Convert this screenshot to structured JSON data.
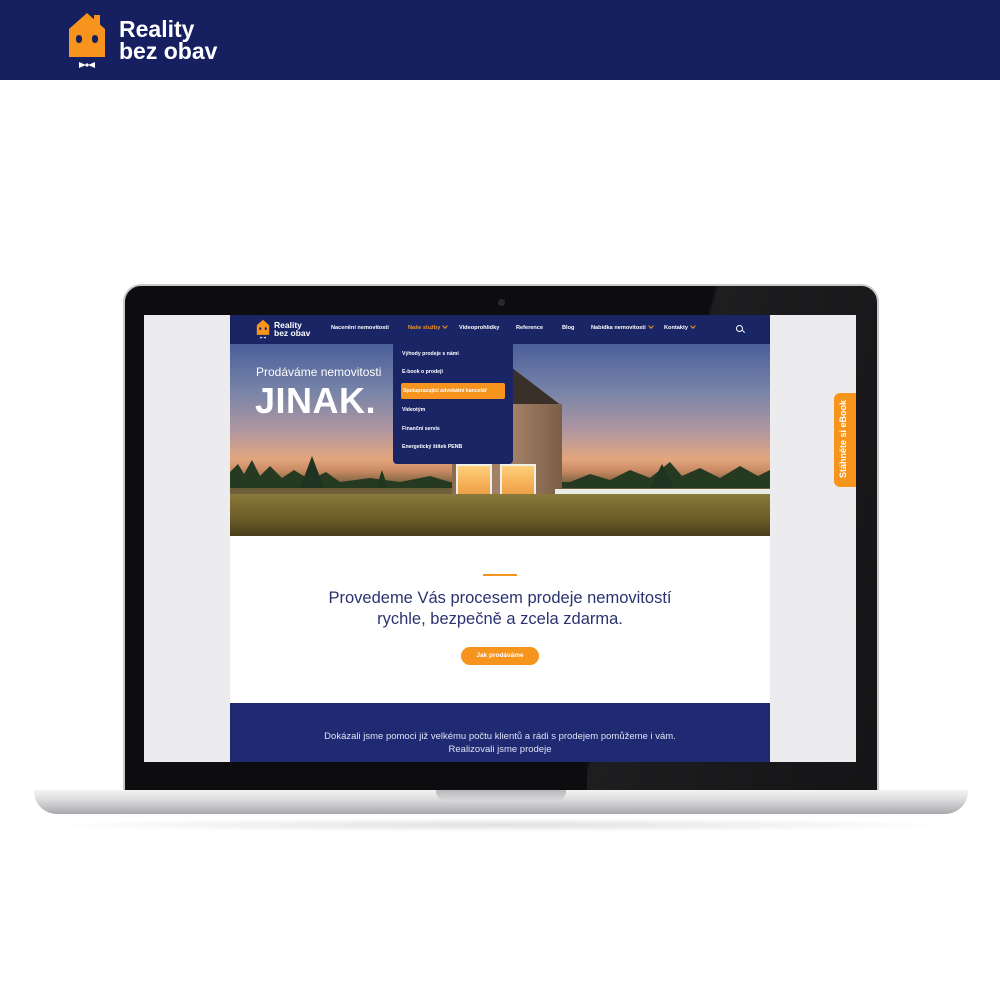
{
  "brand": {
    "line1": "Reality",
    "line2": "bez obav",
    "primary_color": "#161f5f",
    "accent_color": "#f7941d"
  },
  "nav": {
    "items": [
      {
        "label": "Nacenění nemovitostí"
      },
      {
        "label": "Naše služby"
      },
      {
        "label": "Videoprohlídky"
      },
      {
        "label": "Reference"
      },
      {
        "label": "Blog"
      },
      {
        "label": "Nabídka nemovitostí"
      },
      {
        "label": "Kontakty"
      }
    ],
    "search_icon": "search-icon"
  },
  "dropdown": {
    "items": [
      {
        "label": "Výhody prodeje s námi"
      },
      {
        "label": "E-book o prodeji"
      },
      {
        "label": "Spolupracující advokátní kancelář"
      },
      {
        "label": "Videotým"
      },
      {
        "label": "Finanční servis"
      },
      {
        "label": "Energetický štítek PENB"
      }
    ]
  },
  "hero": {
    "subtitle": "Prodáváme nemovitosti",
    "title": "JINAK."
  },
  "content": {
    "lead_line1": "Provedeme Vás procesem prodeje nemovitostí",
    "lead_line2": "rychle, bezpečně a zcela zdarma.",
    "cta_label": "Jak prodáváme",
    "band_line1": "Dokázali jsme pomoci již velkému počtu klientů a rádi s prodejem pomůžeme i vám.",
    "band_line2": "Realizovali jsme prodeje"
  },
  "side_tab": {
    "label": "Stáhněte si eBook"
  }
}
